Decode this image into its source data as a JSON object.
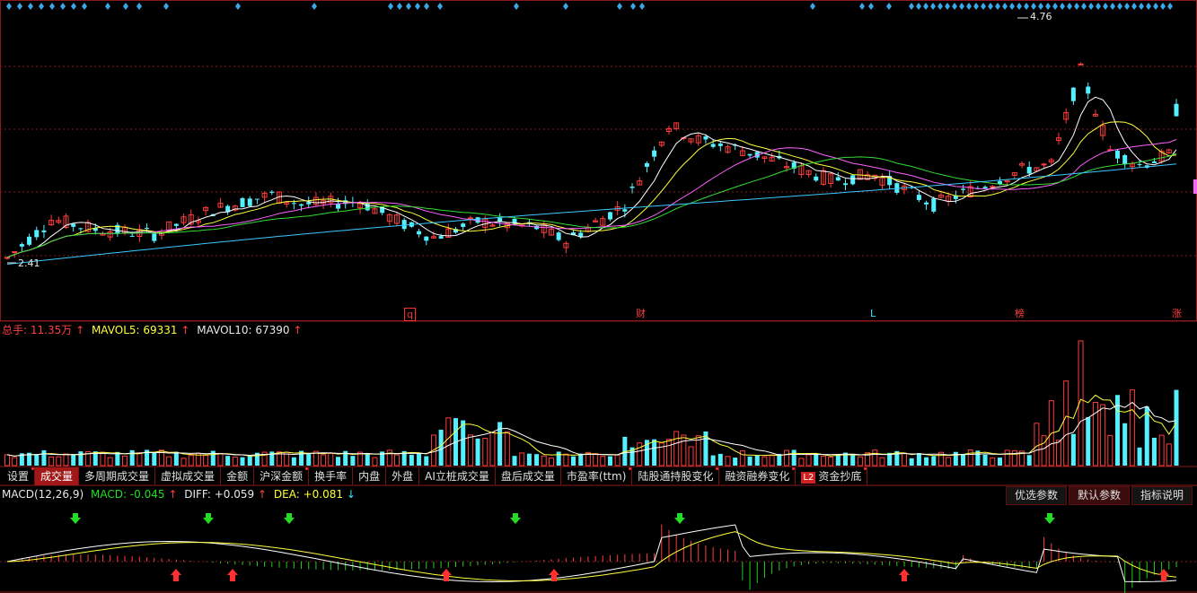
{
  "price_panel": {
    "high_label": "4.76",
    "low_label": "2.41",
    "event_markers": [
      {
        "label": "q",
        "style": "box",
        "color": "#ff3030"
      },
      {
        "label": "财",
        "style": "text",
        "color": "#ff4040"
      },
      {
        "label": "L",
        "style": "text",
        "color": "#3ce2ff"
      },
      {
        "label": "榜",
        "style": "text",
        "color": "#ff4040"
      },
      {
        "label": "涨",
        "style": "text",
        "color": "#ff4040"
      }
    ]
  },
  "volume_panel": {
    "total_label": "总手:",
    "total_value": "11.35万",
    "mavol5_label": "MAVOL5:",
    "mavol5_value": "69331",
    "mavol10_label": "MAVOL10:",
    "mavol10_value": "67390",
    "up_arrow": "↑"
  },
  "indicator_tabs": [
    {
      "label": "设置",
      "active": false,
      "dot": true
    },
    {
      "label": "成交量",
      "active": true,
      "dot": false
    },
    {
      "label": "多周期成交量",
      "active": false,
      "dot": false
    },
    {
      "label": "虚拟成交量",
      "active": false,
      "dot": false
    },
    {
      "label": "金额",
      "active": false,
      "dot": false
    },
    {
      "label": "沪深金额",
      "active": false,
      "dot": true
    },
    {
      "label": "换手率",
      "active": false,
      "dot": false
    },
    {
      "label": "内盘",
      "active": false,
      "dot": false
    },
    {
      "label": "外盘",
      "active": false,
      "dot": false
    },
    {
      "label": "AI立桩成交量",
      "active": false,
      "dot": false
    },
    {
      "label": "盘后成交量",
      "active": false,
      "dot": false
    },
    {
      "label": "市盈率(ttm)",
      "active": false,
      "dot": true
    },
    {
      "label": "陆股通持股变化",
      "active": false,
      "dot": true
    },
    {
      "label": "融资融券变化",
      "active": false,
      "dot": true
    },
    {
      "label": "资金抄底",
      "active": false,
      "dot": true,
      "badge": "L2"
    }
  ],
  "macd_panel": {
    "title": "MACD(12,26,9)",
    "macd_label": "MACD:",
    "macd_value": "-0.045",
    "diff_label": "DIFF:",
    "diff_value": "+0.059",
    "dea_label": "DEA:",
    "dea_value": "+0.081",
    "up_arrow": "↑",
    "down_arrow": "↓",
    "buttons": [
      {
        "label": "优选参数",
        "active": false
      },
      {
        "label": "默认参数",
        "active": true
      },
      {
        "label": "指标说明",
        "active": false
      }
    ]
  },
  "colors": {
    "up": "#ff3c3c",
    "down": "#54f0ff",
    "ma5": "#ffffff",
    "ma10": "#ffff3c",
    "ma20": "#ff60ff",
    "ma30": "#33dd33",
    "ma60": "#3cc8ff",
    "grid": "#8a1a1a",
    "macd_pos": "#ff3c3c",
    "macd_neg": "#22cc22"
  }
}
